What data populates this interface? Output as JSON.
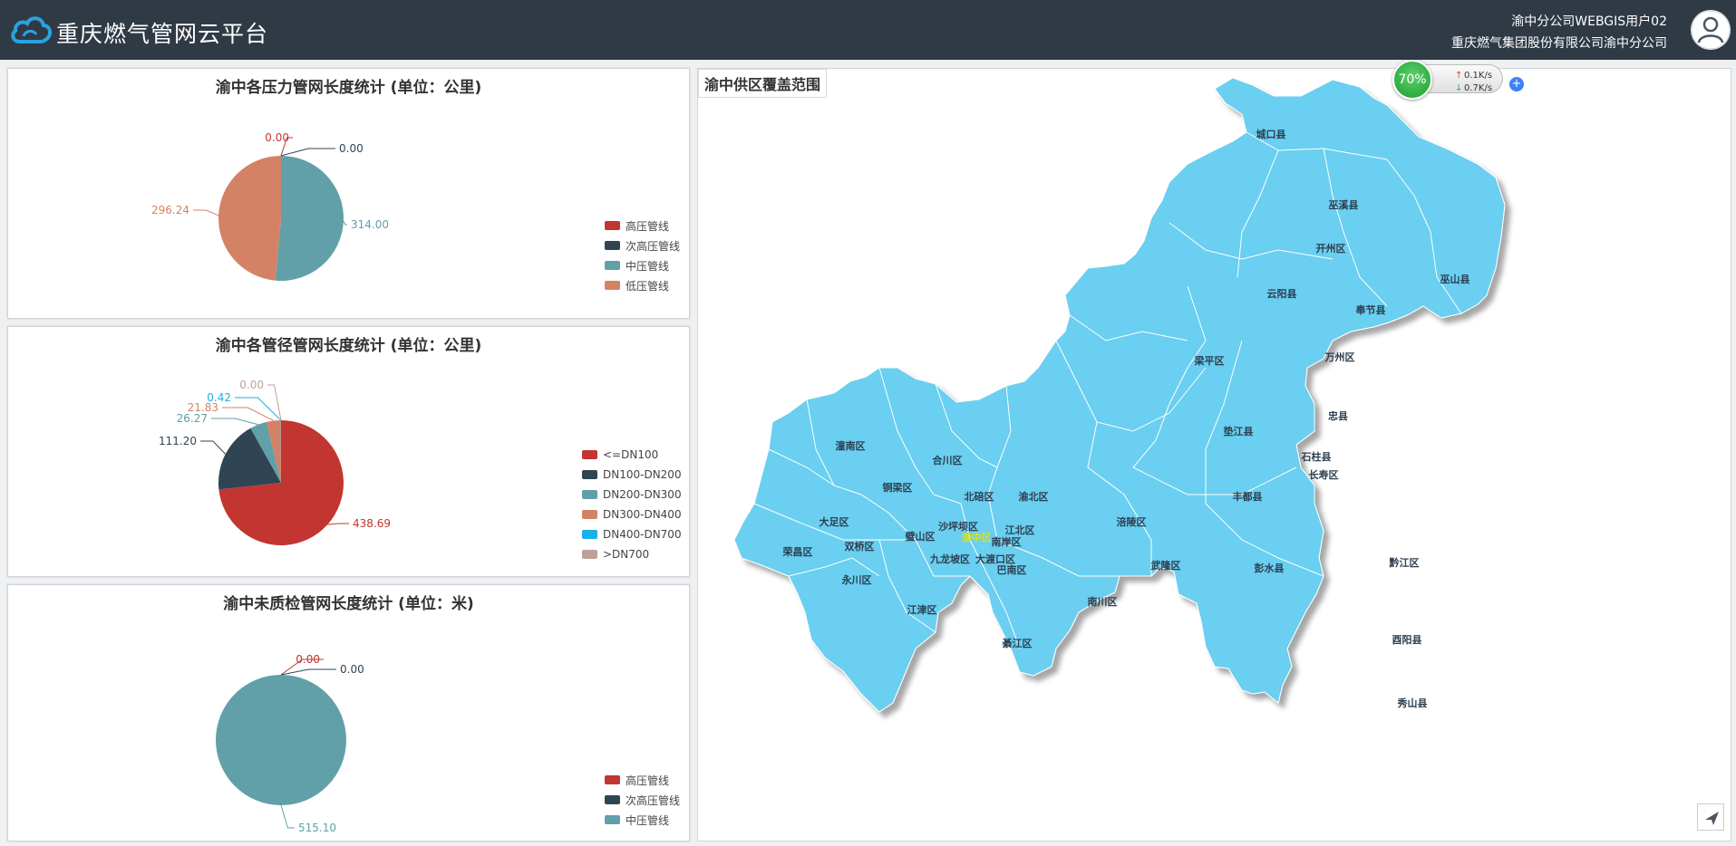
{
  "app": {
    "title": "重庆燃气管网云平台",
    "user_name": "渝中分公司WEBGIS用户02",
    "company": "重庆燃气集团股份有限公司渝中分公司"
  },
  "colors": {
    "header_bg": "#2f3a45",
    "map_fill": "#6acff0",
    "high": "#c23531",
    "sub_high": "#2f4554",
    "medium": "#61a0a8",
    "low": "#d48265",
    "dn400": "#1ab0e8",
    "dn700": "#bda29a"
  },
  "chart_data": [
    {
      "type": "pie",
      "title": "渝中各压力管网长度统计 (单位：公里)",
      "labels": [
        "高压管线",
        "次高压管线",
        "中压管线",
        "低压管线"
      ],
      "values": [
        0.0,
        0.0,
        314.0,
        296.24
      ],
      "value_labels": [
        "0.00",
        "0.00",
        "314.00",
        "296.24"
      ],
      "colors": [
        "#c23531",
        "#2f4554",
        "#61a0a8",
        "#d48265"
      ],
      "legend_position": "right"
    },
    {
      "type": "pie",
      "title": "渝中各管径管网长度统计 (单位：公里)",
      "labels": [
        "<=DN100",
        "DN100-DN200",
        "DN200-DN300",
        "DN300-DN400",
        "DN400-DN700",
        ">DN700"
      ],
      "values": [
        438.69,
        111.2,
        26.27,
        21.83,
        0.42,
        0.0
      ],
      "value_labels": [
        "438.69",
        "111.20",
        "26.27",
        "21.83",
        "0.42",
        "0.00"
      ],
      "colors": [
        "#c23531",
        "#2f4554",
        "#61a0a8",
        "#d48265",
        "#1ab0e8",
        "#bda29a"
      ],
      "legend_position": "right"
    },
    {
      "type": "pie",
      "title": "渝中未质检管网长度统计 (单位：米)",
      "labels": [
        "高压管线",
        "次高压管线",
        "中压管线"
      ],
      "values": [
        0.0,
        0.0,
        515.1
      ],
      "value_labels": [
        "0.00",
        "0.00",
        "515.10"
      ],
      "colors": [
        "#c23531",
        "#2f4554",
        "#61a0a8"
      ],
      "legend_position": "right"
    }
  ],
  "map": {
    "title": "渝中供区覆盖范围",
    "districts": [
      "城口县",
      "巫溪县",
      "开州区",
      "云阳县",
      "奉节县",
      "巫山县",
      "万州区",
      "梁平区",
      "忠县",
      "垫江县",
      "石柱县",
      "长寿区",
      "丰都县",
      "潼南区",
      "合川区",
      "铜梁区",
      "北碚区",
      "渝北区",
      "大足区",
      "沙坪坝区",
      "江北区",
      "璧山区",
      "渝中区",
      "南岸区",
      "双桥区",
      "荣昌区",
      "永川区",
      "九龙坡区",
      "大渡口区",
      "巴南区",
      "涪陵区",
      "武隆区",
      "彭水县",
      "黔江区",
      "南川区",
      "江津区",
      "綦江区",
      "酉阳县",
      "秀山县"
    ]
  },
  "net_widget": {
    "percent": "70%",
    "up": "0.1K/s",
    "down": "0.7K/s"
  }
}
